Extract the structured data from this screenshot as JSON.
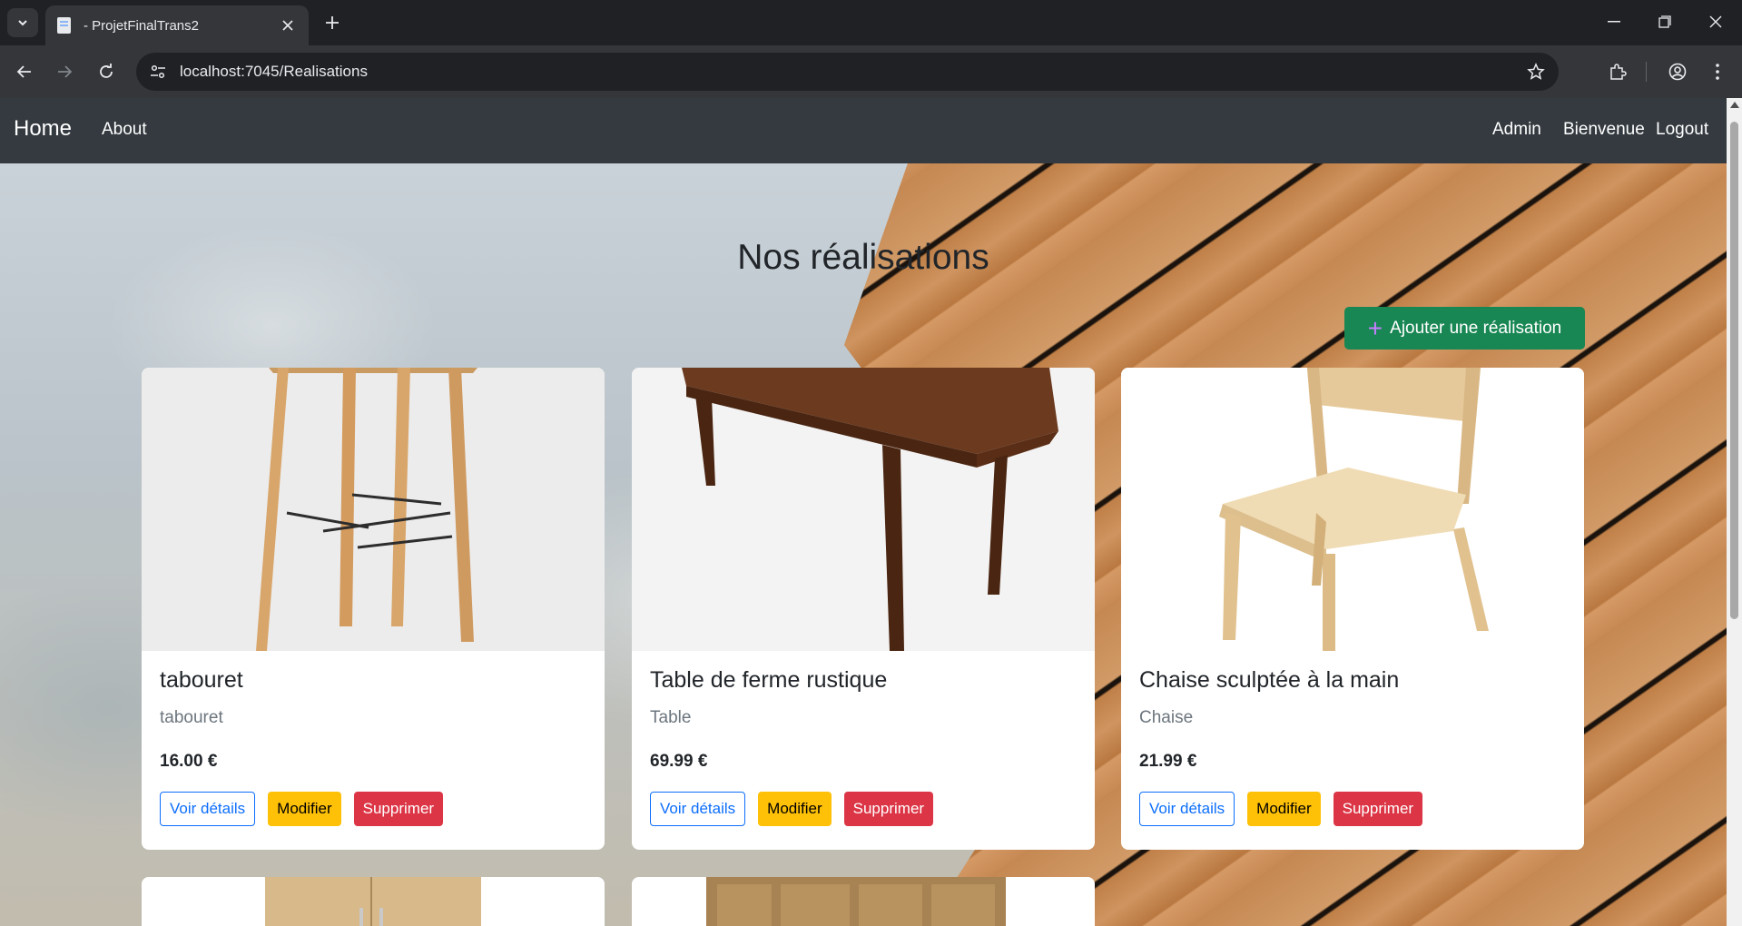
{
  "browser": {
    "tab_title": "- ProjetFinalTrans2",
    "url": "localhost:7045/Realisations"
  },
  "nav": {
    "brand": "Home",
    "about": "About",
    "admin": "Admin",
    "welcome": "Bienvenue",
    "logout": "Logout"
  },
  "page": {
    "heading": "Nos réalisations",
    "add_button": "Ajouter une réalisation"
  },
  "cards": [
    {
      "title": "tabouret",
      "subtitle": "tabouret",
      "price": "16.00 €",
      "details": "Voir détails",
      "edit": "Modifier",
      "delete": "Supprimer"
    },
    {
      "title": "Table de ferme rustique",
      "subtitle": "Table",
      "price": "69.99 €",
      "details": "Voir détails",
      "edit": "Modifier",
      "delete": "Supprimer"
    },
    {
      "title": "Chaise sculptée à la main",
      "subtitle": "Chaise",
      "price": "21.99 €",
      "details": "Voir détails",
      "edit": "Modifier",
      "delete": "Supprimer"
    }
  ],
  "colors": {
    "navbar": "#343a40",
    "success": "#198754",
    "warning": "#ffc107",
    "danger": "#dc3545",
    "primary": "#0d6efd"
  }
}
